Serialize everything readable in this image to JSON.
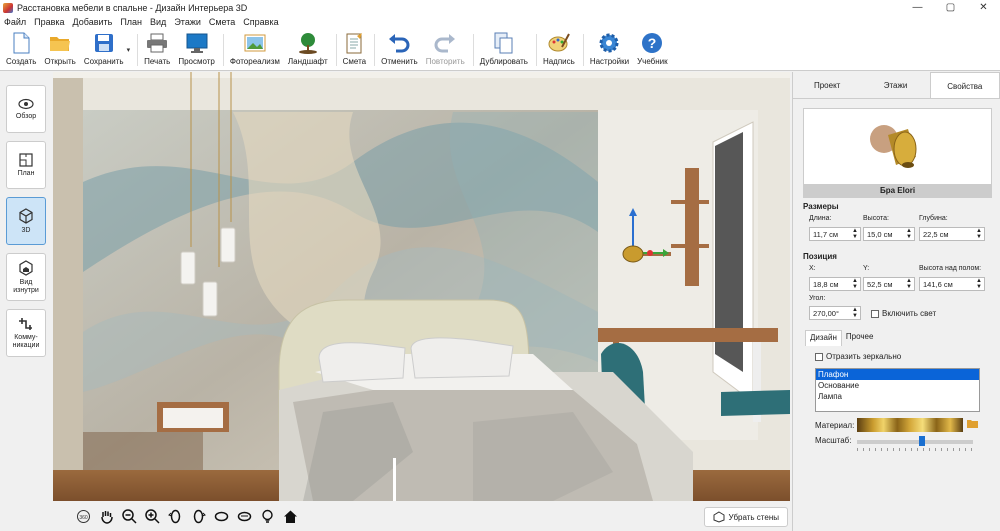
{
  "window": {
    "title": "Расстановка мебели в спальне - Дизайн Интерьера 3D",
    "min": "—",
    "max": "▢",
    "close": "✕"
  },
  "menu": [
    "Файл",
    "Правка",
    "Добавить",
    "План",
    "Вид",
    "Этажи",
    "Смета",
    "Справка"
  ],
  "toolbar": {
    "create": "Создать",
    "open": "Открыть",
    "save": "Сохранить",
    "print": "Печать",
    "preview": "Просмотр",
    "photo": "Фотореализм",
    "landscape": "Ландшафт",
    "estimate": "Смета",
    "undo": "Отменить",
    "redo": "Повторить",
    "duplicate": "Дублировать",
    "caption": "Надпись",
    "settings": "Настройки",
    "tutorial": "Учебник",
    "dropdown": "▾"
  },
  "nav": {
    "overview": "Обзор",
    "plan": "План",
    "view3d": "3D",
    "inside": "Вид изнутри",
    "comms": "Комму-\nникации"
  },
  "bottom": {
    "remove_walls": "Убрать стены"
  },
  "panel": {
    "tabs": [
      "Проект",
      "Этажи",
      "Свойства"
    ],
    "object_name": "Бра Elori",
    "sizes": {
      "title": "Размеры",
      "length_label": "Длина:",
      "length": "11,7 см",
      "height_label": "Высота:",
      "height": "15,0 см",
      "depth_label": "Глубина:",
      "depth": "22,5 см"
    },
    "position": {
      "title": "Позиция",
      "x_label": "X:",
      "x": "18,8 см",
      "y_label": "Y:",
      "y": "52,5 см",
      "floor_label": "Высота над полом:",
      "floor": "141,6 см",
      "angle_label": "Угол:",
      "angle": "270,00°",
      "light_label": "Включить свет"
    },
    "subtabs": [
      "Дизайн",
      "Прочее"
    ],
    "mirror_label": "Отразить зеркально",
    "parts": [
      "Плафон",
      "Основание",
      "Лампа"
    ],
    "material_label": "Материал:",
    "scale_label": "Масштаб:"
  },
  "colors": {
    "accent": "#0a64d8",
    "gold": "#c99b2e",
    "teal": "#2e6f77"
  }
}
